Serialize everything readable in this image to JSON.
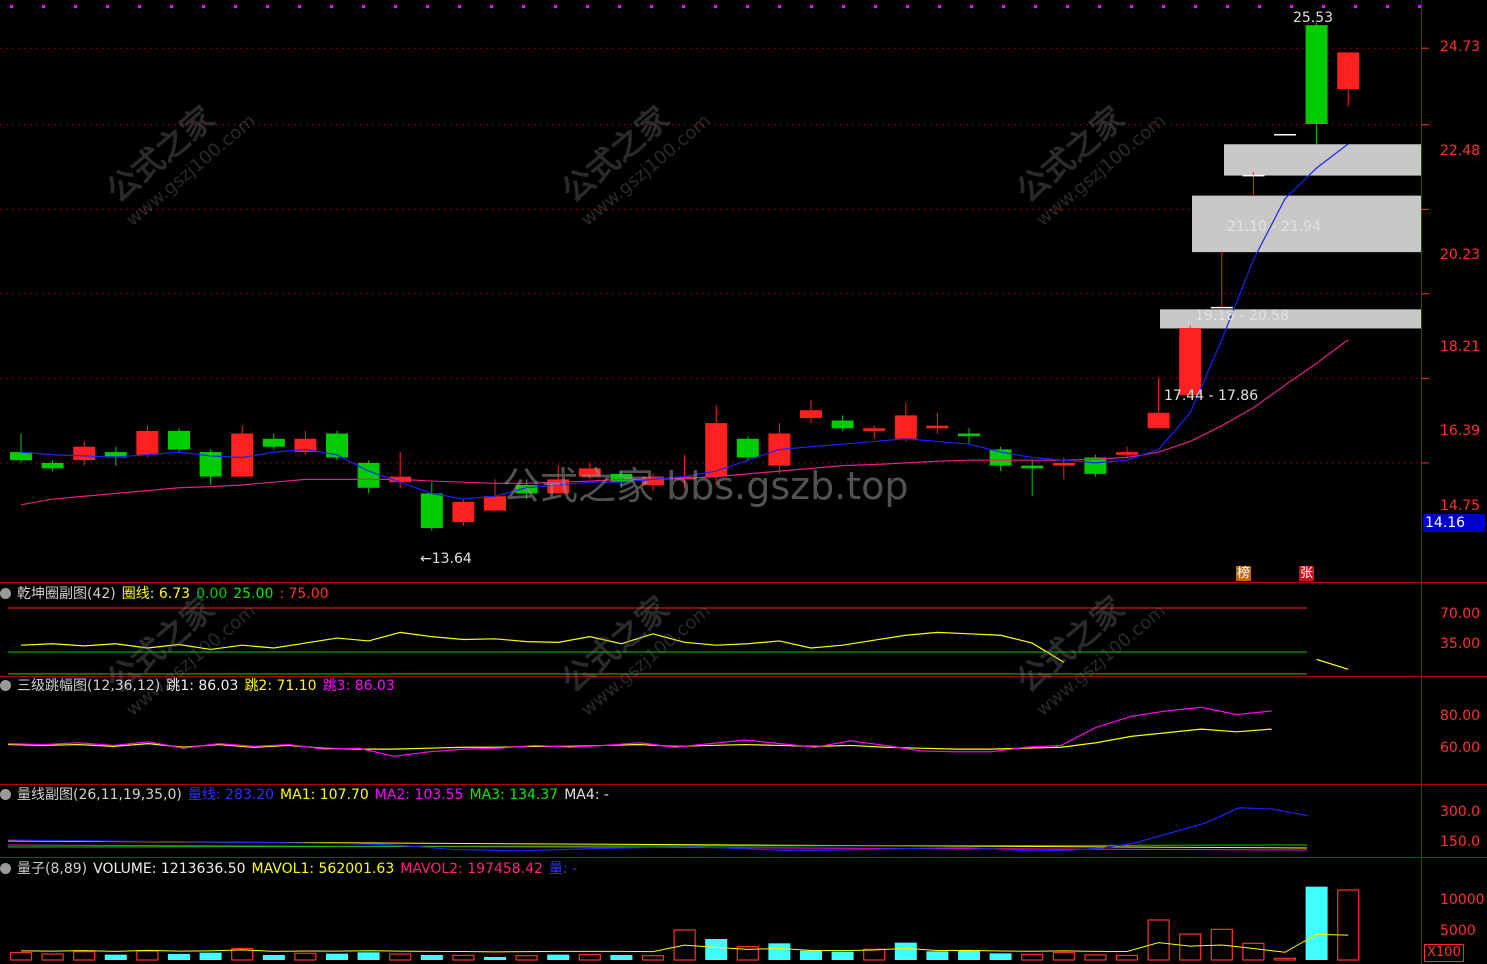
{
  "price_axis": {
    "ticks": [
      "24.73",
      "22.48",
      "20.23",
      "18.21",
      "16.39",
      "14.75"
    ],
    "current": "14.16"
  },
  "annotations": {
    "high": "25.53",
    "low": "←13.64",
    "zones": [
      "21.10 - 21.94",
      "19.18 - 20.58",
      "17.44 - 17.86"
    ]
  },
  "badges": {
    "b1": "榜",
    "b2": "张"
  },
  "panels": {
    "p1": {
      "name": "乾坤圈副图",
      "params": "(42)",
      "v1": "圈线: 6.73",
      "v2": "0.00",
      "v3": "25.00",
      "v4": ": 75.00",
      "ticks": [
        "70.00",
        "35.00"
      ]
    },
    "p2": {
      "name": "三级跳幅图",
      "params": "(12,36,12)",
      "v1": "跳1: 86.03",
      "v2": "跳2: 71.10",
      "v3": "跳3: 86.03",
      "ticks": [
        "80.00",
        "60.00"
      ]
    },
    "p3": {
      "name": "量线副图",
      "params": "(26,11,19,35,0)",
      "v1": "量线: 283.20",
      "v2": "MA1: 107.70",
      "v3": "MA2: 103.55",
      "v4": "MA3: 134.37",
      "v5": "MA4: -",
      "ticks": [
        "300.0",
        "150.0"
      ]
    },
    "p4": {
      "name": "量子",
      "params": "(8,89)",
      "v1": "VOLUME: 1213636.50",
      "v2": "MAVOL1: 562001.63",
      "v3": "MAVOL2: 197458.42",
      "v4": "量: -",
      "ticks": [
        "10000",
        "5000"
      ],
      "unit": "X100"
    }
  },
  "watermarks": {
    "main": "公式之家 bbs.gszb.top",
    "cn": "公式之家",
    "url": "www.gszj100.com"
  },
  "colors": {
    "up": "#ff2020",
    "down": "#00cc00",
    "ma_blue": "#2020ff",
    "ma_pink": "#e0208a",
    "grid": "#8b0000",
    "yellow": "#ffff00",
    "magenta": "#ff00ff",
    "cyan": "#40ffff"
  },
  "chart_data": {
    "type": "candlestick",
    "ylim": [
      13.2,
      26.0
    ],
    "candles": [
      {
        "o": 14.95,
        "c": 14.8,
        "h": 15.3,
        "l": 14.75
      },
      {
        "o": 14.75,
        "c": 14.65,
        "h": 14.8,
        "l": 14.6
      },
      {
        "o": 14.8,
        "c": 15.05,
        "h": 15.15,
        "l": 14.7
      },
      {
        "o": 14.95,
        "c": 14.85,
        "h": 15.05,
        "l": 14.7
      },
      {
        "o": 14.9,
        "c": 15.35,
        "h": 15.45,
        "l": 14.85
      },
      {
        "o": 15.35,
        "c": 15.0,
        "h": 15.4,
        "l": 14.95
      },
      {
        "o": 14.95,
        "c": 14.5,
        "h": 15.0,
        "l": 14.35
      },
      {
        "o": 14.5,
        "c": 15.3,
        "h": 15.45,
        "l": 14.5
      },
      {
        "o": 15.2,
        "c": 15.05,
        "h": 15.3,
        "l": 15.0
      },
      {
        "o": 14.95,
        "c": 15.2,
        "h": 15.35,
        "l": 14.9
      },
      {
        "o": 15.3,
        "c": 14.85,
        "h": 15.35,
        "l": 14.8
      },
      {
        "o": 14.75,
        "c": 14.3,
        "h": 14.8,
        "l": 14.2
      },
      {
        "o": 14.4,
        "c": 14.5,
        "h": 14.95,
        "l": 14.3
      },
      {
        "o": 14.2,
        "c": 13.6,
        "h": 14.4,
        "l": 13.55
      },
      {
        "o": 13.7,
        "c": 14.05,
        "h": 14.1,
        "l": 13.64
      },
      {
        "o": 13.9,
        "c": 14.15,
        "h": 14.45,
        "l": 13.9
      },
      {
        "o": 14.35,
        "c": 14.2,
        "h": 14.45,
        "l": 14.1
      },
      {
        "o": 14.2,
        "c": 14.45,
        "h": 14.7,
        "l": 14.2
      },
      {
        "o": 14.5,
        "c": 14.65,
        "h": 14.75,
        "l": 14.45
      },
      {
        "o": 14.55,
        "c": 14.4,
        "h": 14.6,
        "l": 14.3
      },
      {
        "o": 14.35,
        "c": 14.5,
        "h": 14.55,
        "l": 14.25
      },
      {
        "o": 14.45,
        "c": 14.5,
        "h": 14.9,
        "l": 14.3
      },
      {
        "o": 14.5,
        "c": 15.5,
        "h": 15.85,
        "l": 14.35
      },
      {
        "o": 15.2,
        "c": 14.85,
        "h": 15.25,
        "l": 14.8
      },
      {
        "o": 14.7,
        "c": 15.3,
        "h": 15.5,
        "l": 14.55
      },
      {
        "o": 15.6,
        "c": 15.75,
        "h": 15.95,
        "l": 15.5
      },
      {
        "o": 15.55,
        "c": 15.4,
        "h": 15.65,
        "l": 15.35
      },
      {
        "o": 15.35,
        "c": 15.4,
        "h": 15.45,
        "l": 15.2
      },
      {
        "o": 15.2,
        "c": 15.65,
        "h": 15.9,
        "l": 15.15
      },
      {
        "o": 15.4,
        "c": 15.45,
        "h": 15.7,
        "l": 15.3
      },
      {
        "o": 15.3,
        "c": 15.25,
        "h": 15.4,
        "l": 15.1
      },
      {
        "o": 15.0,
        "c": 14.7,
        "h": 15.05,
        "l": 14.6
      },
      {
        "o": 14.7,
        "c": 14.65,
        "h": 14.8,
        "l": 14.15
      },
      {
        "o": 14.7,
        "c": 14.75,
        "h": 14.85,
        "l": 14.45
      },
      {
        "o": 14.85,
        "c": 14.55,
        "h": 14.9,
        "l": 14.5
      },
      {
        "o": 14.9,
        "c": 14.95,
        "h": 15.05,
        "l": 14.85
      },
      {
        "o": 15.4,
        "c": 15.7,
        "h": 16.4,
        "l": 15.4
      },
      {
        "o": 16.05,
        "c": 17.45,
        "h": 17.5,
        "l": 16.05
      },
      {
        "o": 17.9,
        "c": 17.9,
        "h": 19.2,
        "l": 17.9
      },
      {
        "o": 21.1,
        "c": 21.1,
        "h": 21.2,
        "l": 20.6
      },
      {
        "o": 22.2,
        "c": 22.2,
        "h": 22.2,
        "l": 22.2
      },
      {
        "o": 25.45,
        "c": 22.5,
        "h": 25.53,
        "l": 21.95
      },
      {
        "o": 23.5,
        "c": 24.6,
        "h": 24.6,
        "l": 23.0
      }
    ],
    "ma_blue": [
      14.95,
      14.9,
      14.88,
      14.86,
      14.9,
      14.95,
      14.88,
      14.85,
      14.95,
      15.0,
      14.9,
      14.6,
      14.4,
      14.2,
      14.1,
      14.15,
      14.3,
      14.35,
      14.4,
      14.4,
      14.45,
      14.5,
      14.6,
      14.8,
      15.0,
      15.05,
      15.1,
      15.15,
      15.2,
      15.15,
      15.1,
      14.95,
      14.85,
      14.8,
      14.75,
      14.8,
      15.0,
      15.7,
      17.2,
      19.0,
      20.5,
      21.3,
      21.95
    ],
    "ma_pink": [
      14.0,
      14.1,
      14.15,
      14.2,
      14.25,
      14.3,
      14.32,
      14.35,
      14.4,
      14.45,
      14.45,
      14.45,
      14.45,
      14.42,
      14.4,
      14.38,
      14.38,
      14.4,
      14.42,
      14.45,
      14.45,
      14.47,
      14.5,
      14.55,
      14.6,
      14.65,
      14.7,
      14.72,
      14.75,
      14.78,
      14.8,
      14.8,
      14.8,
      14.8,
      14.82,
      14.85,
      14.95,
      15.15,
      15.45,
      15.8,
      16.25,
      16.7,
      17.2
    ],
    "p1_line": [
      42,
      44,
      41,
      44,
      38,
      43,
      36,
      42,
      38,
      45,
      52,
      48,
      60,
      54,
      50,
      51,
      47,
      46,
      54,
      44,
      58,
      46,
      42,
      44,
      48,
      38,
      42,
      49,
      56,
      60,
      58,
      56,
      45,
      18,
      null,
      null,
      null,
      null,
      null,
      null,
      null,
      22,
      8
    ],
    "p2_jump1": [
      62,
      61,
      63,
      60,
      64,
      57,
      62,
      59,
      61,
      56,
      57,
      48,
      53,
      56,
      57,
      60,
      58,
      60,
      63,
      58,
      62,
      66,
      62,
      58,
      65,
      60,
      54,
      53,
      53,
      58,
      60,
      80,
      92,
      98,
      102,
      94,
      98
    ],
    "p2_jump2": [
      61,
      60,
      61,
      59,
      62,
      58,
      61,
      58,
      60,
      57,
      56,
      56,
      57,
      58,
      58,
      59,
      59,
      60,
      61,
      59,
      60,
      61,
      60,
      59,
      60,
      58,
      57,
      56,
      56,
      57,
      58,
      63,
      70,
      74,
      78,
      75,
      78
    ],
    "p3_line": [
      108,
      105,
      104,
      100,
      98,
      96,
      94,
      90,
      88,
      84,
      80,
      76,
      60,
      40,
      35,
      30,
      38,
      45,
      50,
      55,
      60,
      50,
      40,
      30,
      35,
      40,
      45,
      50,
      55,
      40,
      30,
      35,
      50,
      90,
      160,
      230,
      340,
      330,
      283
    ],
    "volume": [
      2200,
      1800,
      2500,
      1600,
      2700,
      1800,
      2200,
      3400,
      1500,
      2000,
      1900,
      2300,
      1800,
      1500,
      1400,
      900,
      1300,
      1600,
      1600,
      1500,
      1300,
      9000,
      6300,
      4000,
      5000,
      2800,
      2500,
      3200,
      5200,
      2600,
      2800,
      2000,
      1700,
      2200,
      1500,
      1400,
      12000,
      7800,
      9200,
      5000,
      500,
      22000,
      21000
    ],
    "volume_up": [
      true,
      true,
      true,
      false,
      true,
      false,
      false,
      true,
      false,
      true,
      false,
      false,
      true,
      false,
      true,
      false,
      true,
      false,
      true,
      false,
      true,
      true,
      false,
      true,
      false,
      false,
      false,
      true,
      false,
      false,
      false,
      false,
      true,
      true,
      true,
      true,
      true,
      true,
      true,
      true,
      true,
      false,
      true
    ]
  }
}
